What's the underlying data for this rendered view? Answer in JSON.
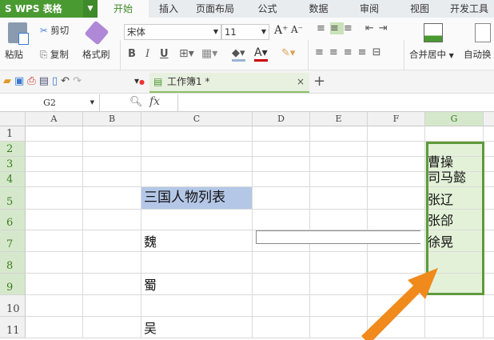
{
  "app": {
    "logo": "S WPS 表格"
  },
  "tabs": [
    "开始",
    "插入",
    "页面布局",
    "公式",
    "数据",
    "审阅",
    "视图",
    "开发工具"
  ],
  "ribbon": {
    "paste": "粘贴",
    "cut": "剪切",
    "copy": "复制",
    "format_painter": "格式刷",
    "font_name": "宋体",
    "font_size": "11",
    "merge_center": "合并居中",
    "auto_wrap": "自动换"
  },
  "document_tab": {
    "title": "工作簿1 *"
  },
  "formula_bar": {
    "name_box": "G2",
    "fx": "fx",
    "value": ""
  },
  "columns": [
    "A",
    "B",
    "C",
    "D",
    "E",
    "F",
    "G"
  ],
  "rows": [
    "1",
    "2",
    "3",
    "4",
    "5",
    "6",
    "7",
    "8",
    "9",
    "10",
    "11"
  ],
  "cells": {
    "C5": "三国人物列表",
    "C7": "魏",
    "C9": "蜀",
    "C11": "吴",
    "G3": "曹操",
    "G4": "司马懿",
    "G5": "张辽",
    "G6": "张郃",
    "G7": "徐晃"
  },
  "selection": "G2:G9",
  "colors": {
    "accent": "#4a9a32",
    "selection_border": "#5f9a3c",
    "selection_fill": "#e3f1d8",
    "title_fill": "#b4c7e7",
    "arrow": "#f08a1c"
  }
}
